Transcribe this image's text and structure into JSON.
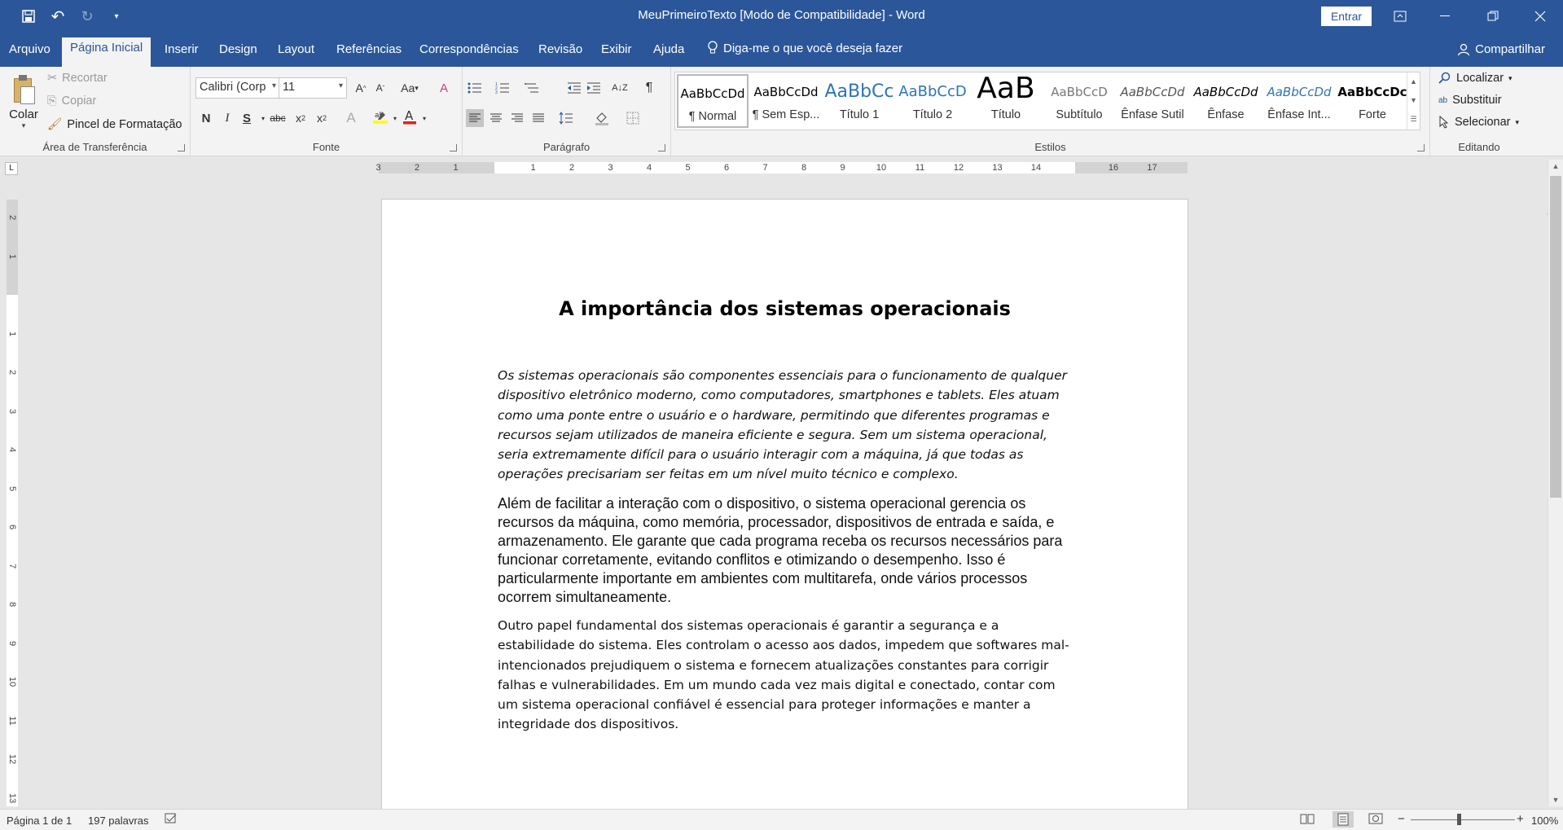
{
  "window": {
    "title": "MeuPrimeiroTexto [Modo de Compatibilidade]  -  Word",
    "signin_label": "Entrar"
  },
  "qat": {
    "undo_glyph": "↶",
    "redo_glyph": "↻",
    "customize_glyph": "▾"
  },
  "tabs": [
    "Arquivo",
    "Página Inicial",
    "Inserir",
    "Design",
    "Layout",
    "Referências",
    "Correspondências",
    "Revisão",
    "Exibir",
    "Ajuda"
  ],
  "tellme": "Diga-me o que você deseja fazer",
  "share": "Compartilhar",
  "clipboard": {
    "paste": "Colar",
    "cut": "Recortar",
    "copy": "Copiar",
    "format_painter": "Pincel de Formatação",
    "label": "Área de Transferência"
  },
  "font": {
    "family": "Calibri (Corp",
    "size": "11",
    "label": "Fonte",
    "case_label": "Aa",
    "bold": "N",
    "italic": "I",
    "underline": "S",
    "strike": "abc"
  },
  "paragraph": {
    "label": "Parágrafo"
  },
  "styles": {
    "label": "Estilos",
    "items": [
      {
        "preview": "AaBbCcDd",
        "name": "¶ Normal"
      },
      {
        "preview": "AaBbCcDd",
        "name": "¶ Sem Esp..."
      },
      {
        "preview": "AaBbCc",
        "name": "Título 1"
      },
      {
        "preview": "AaBbCcD",
        "name": "Título 2"
      },
      {
        "preview": "AaB",
        "name": "Título"
      },
      {
        "preview": "AaBbCcD",
        "name": "Subtítulo"
      },
      {
        "preview": "AaBbCcDd",
        "name": "Ênfase Sutil"
      },
      {
        "preview": "AaBbCcDd",
        "name": "Ênfase"
      },
      {
        "preview": "AaBbCcDd",
        "name": "Ênfase Int..."
      },
      {
        "preview": "AaBbCcDc",
        "name": "Forte"
      }
    ]
  },
  "editing": {
    "find": "Localizar",
    "replace": "Substituir",
    "select": "Selecionar",
    "label": "Editando"
  },
  "document": {
    "heading": "A importância dos sistemas operacionais",
    "p1": "Os sistemas operacionais são componentes essenciais para o funcionamento de qualquer dispositivo eletrônico moderno, como computadores, smartphones e tablets. Eles atuam como uma ponte entre o usuário e o hardware, permitindo que diferentes programas e recursos sejam utilizados de maneira eficiente e segura. Sem um sistema operacional, seria extremamente difícil para o usuário interagir com a máquina, já que todas as operações precisariam ser feitas em um nível muito técnico e complexo.",
    "p2": "Além de facilitar a interação com o dispositivo, o sistema operacional gerencia os recursos da máquina, como memória, processador, dispositivos de entrada e saída, e armazenamento. Ele garante que cada programa receba os recursos necessários para funcionar corretamente, evitando conflitos e otimizando o desempenho. Isso é particularmente importante em ambientes com multitarefa, onde vários processos ocorrem simultaneamente.",
    "p3": "Outro papel fundamental dos sistemas operacionais é garantir a segurança e a estabilidade do sistema. Eles controlam o acesso aos dados, impedem que softwares mal-intencionados prejudiquem o sistema e fornecem atualizações constantes para corrigir falhas e vulnerabilidades. Em um mundo cada vez mais digital e conectado, contar com um sistema operacional confiável é essencial para proteger informações e manter a integridade dos dispositivos."
  },
  "ruler": {
    "h_labels": [
      "3",
      "2",
      "1",
      "1",
      "2",
      "3",
      "4",
      "5",
      "6",
      "7",
      "8",
      "9",
      "10",
      "11",
      "12",
      "13",
      "14",
      "16",
      "17"
    ],
    "v_labels": [
      "2",
      "1",
      "1",
      "2",
      "3",
      "4",
      "5",
      "6",
      "7",
      "8",
      "9",
      "10",
      "11",
      "12",
      "13"
    ]
  },
  "status": {
    "page": "Página 1 de 1",
    "words": "197 palavras",
    "zoom": "100%",
    "zoom_minus": "−",
    "zoom_plus": "+"
  },
  "colors": {
    "accent": "#2b579a",
    "ribbon": "#f3f3f3",
    "canvas": "#e6e6e6"
  }
}
